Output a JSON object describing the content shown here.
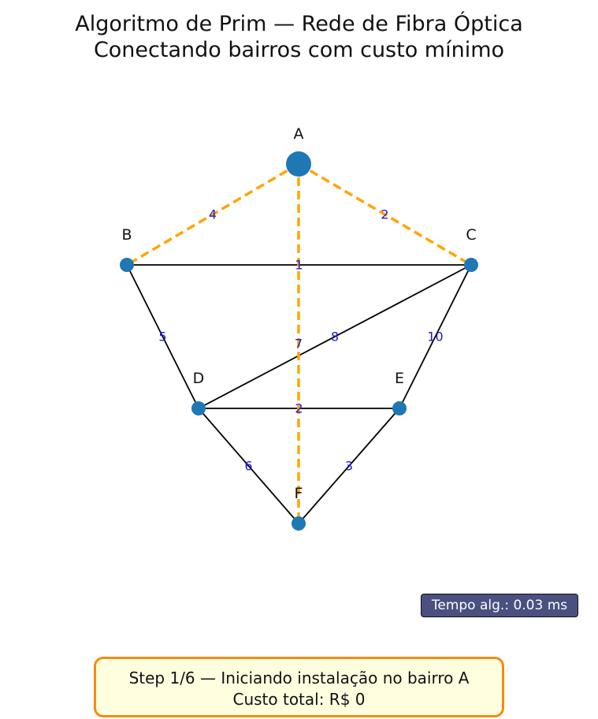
{
  "title": {
    "line1": "Algoritmo de Prim — Rede de Fibra Óptica",
    "line2": "Conectando bairros com custo mínimo"
  },
  "graph": {
    "nodes": [
      {
        "id": "A",
        "label": "A",
        "highlighted": true
      },
      {
        "id": "B",
        "label": "B"
      },
      {
        "id": "C",
        "label": "C"
      },
      {
        "id": "D",
        "label": "D"
      },
      {
        "id": "E",
        "label": "E"
      },
      {
        "id": "F",
        "label": "F"
      }
    ],
    "edges": [
      {
        "from": "A",
        "to": "B",
        "weight": "4",
        "candidate": true
      },
      {
        "from": "A",
        "to": "C",
        "weight": "2",
        "candidate": true
      },
      {
        "from": "A",
        "to": "F",
        "weight": "7",
        "candidate": true
      },
      {
        "from": "B",
        "to": "C",
        "weight": "1"
      },
      {
        "from": "B",
        "to": "D",
        "weight": "5"
      },
      {
        "from": "C",
        "to": "D",
        "weight": "8"
      },
      {
        "from": "C",
        "to": "E",
        "weight": "10"
      },
      {
        "from": "D",
        "to": "E",
        "weight": "2"
      },
      {
        "from": "D",
        "to": "F",
        "weight": "6"
      },
      {
        "from": "E",
        "to": "F",
        "weight": "3"
      }
    ],
    "colors": {
      "node": "#1f77b4",
      "edge": "#000000",
      "candidate_edge": "#ffa500",
      "edge_label": "#1a1ad6"
    }
  },
  "timer": {
    "text": "Tempo alg.: 0.03 ms"
  },
  "status": {
    "step": "Step 1/6 — Iniciando instalação no bairro A",
    "cost": "Custo total: R$ 0"
  }
}
